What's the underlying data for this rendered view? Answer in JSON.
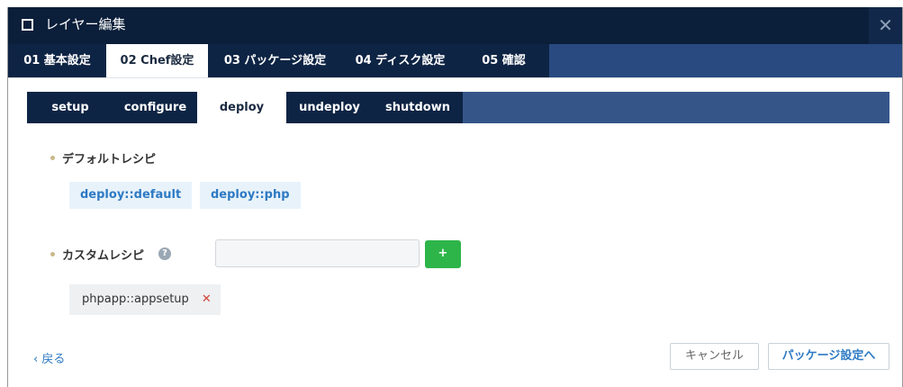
{
  "window": {
    "title": "レイヤー編集",
    "close_symbol": "✕"
  },
  "main_tabs": [
    {
      "label": "01 基本設定",
      "active": false
    },
    {
      "label": "02 Chef設定",
      "active": true
    },
    {
      "label": "03 パッケージ設定",
      "active": false
    },
    {
      "label": "04 ディスク設定",
      "active": false
    },
    {
      "label": "05 確認",
      "active": false
    }
  ],
  "sub_tabs": [
    {
      "label": "setup",
      "active": false
    },
    {
      "label": "configure",
      "active": false
    },
    {
      "label": "deploy",
      "active": true
    },
    {
      "label": "undeploy",
      "active": false
    },
    {
      "label": "shutdown",
      "active": false
    }
  ],
  "default_recipes": {
    "label": "デフォルトレシピ",
    "items": [
      "deploy::default",
      "deploy::php"
    ]
  },
  "custom_recipes": {
    "label": "カスタムレシピ",
    "help_symbol": "?",
    "input_value": "",
    "add_label": "+",
    "items": [
      {
        "name": "phpapp::appsetup",
        "remove_symbol": "✕"
      }
    ]
  },
  "footer": {
    "back_label": "‹ 戻る",
    "cancel_label": "キャンセル",
    "next_label": "パッケージ設定へ"
  }
}
